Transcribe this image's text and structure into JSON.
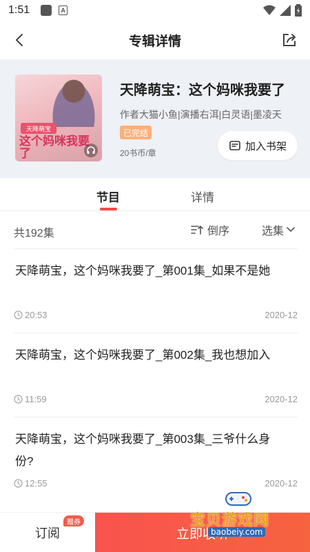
{
  "status_bar": {
    "time": "1:51",
    "notif_letter": "A"
  },
  "header": {
    "title": "专辑详情"
  },
  "album": {
    "cover_band": "天降萌宝",
    "cover_title": "这个妈咪我要了",
    "title": "天降萌宝：这个妈咪我要了",
    "meta": "作者大猫小鱼|演播右洱|白灵语|墨凌天",
    "status_badge": "已完结",
    "price": "20书币/章",
    "shelf_label": "加入书架"
  },
  "tabs": [
    {
      "label": "节目",
      "active": true
    },
    {
      "label": "详情",
      "active": false
    }
  ],
  "list_toolbar": {
    "count": "共192集",
    "sort_label": "倒序",
    "select_label": "选集"
  },
  "episodes": [
    {
      "title": "天降萌宝，这个妈咪我要了_第001集_如果不是她",
      "duration": "20:53",
      "date": "2020-12"
    },
    {
      "title": "天降萌宝，这个妈咪我要了_第002集_我也想加入",
      "duration": "11:59",
      "date": "2020-12"
    },
    {
      "title": "天降萌宝，这个妈咪我要了_第003集_三爷什么身份?",
      "duration": "12:55",
      "date": "2020-12"
    }
  ],
  "bottom_bar": {
    "subscribe_label": "订阅",
    "voucher_badge": "赠券",
    "listen_label": "立即收听"
  },
  "watermark": {
    "text": "宝贝游戏网",
    "url": "baobeiy.com"
  },
  "colors": {
    "accent": "#f44a45",
    "badge_orange": "#fdb07a",
    "card_bg": "#eef1f6"
  }
}
